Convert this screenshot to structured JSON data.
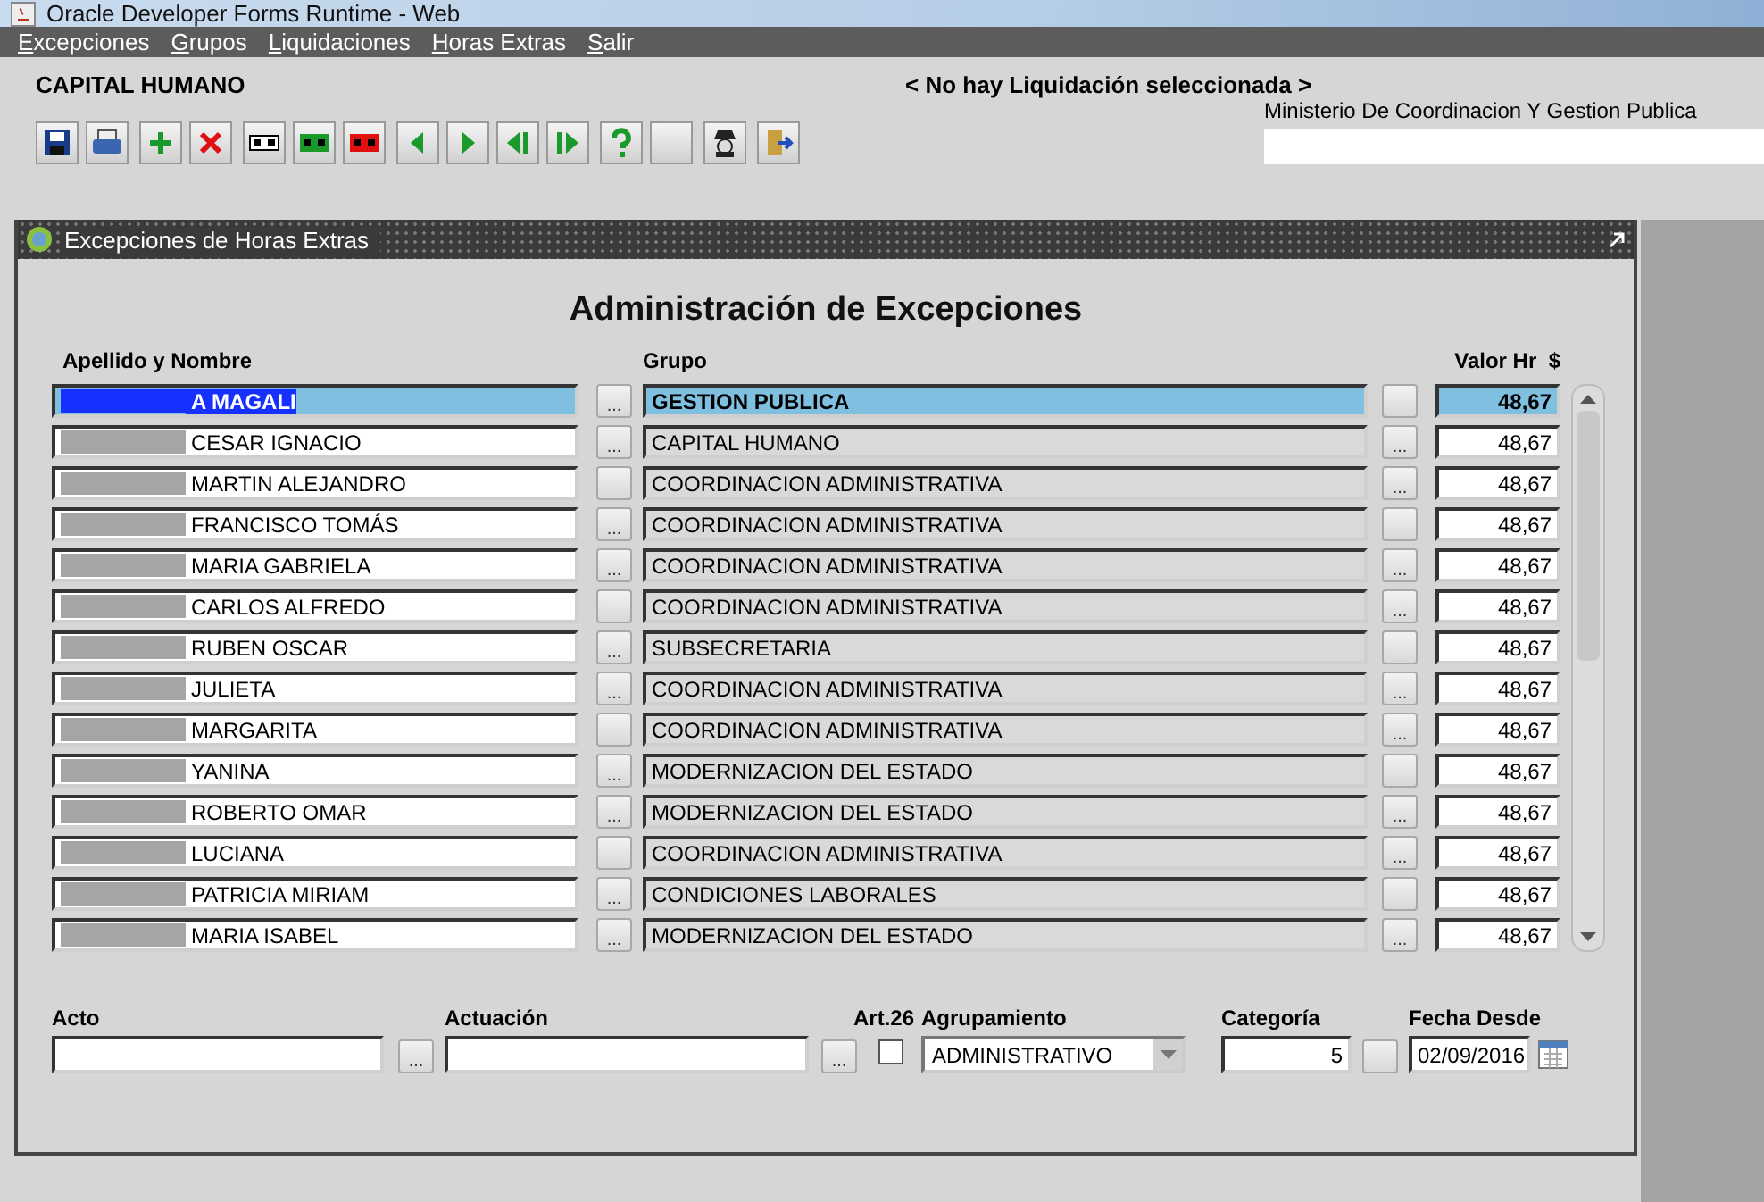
{
  "window": {
    "title": "Oracle Developer Forms Runtime - Web"
  },
  "menu": [
    "Excepciones",
    "Grupos",
    "Liquidaciones",
    "Horas Extras",
    "Salir"
  ],
  "header": {
    "area": "CAPITAL HUMANO",
    "liquidacion": "< No hay Liquidación seleccionada >",
    "ministerio": "Ministerio De Coordinacion Y Gestion Publica"
  },
  "form": {
    "title": "Excepciones de Horas Extras",
    "heading": "Administración de Excepciones",
    "columns": [
      "Apellido y Nombre",
      "Grupo",
      "Valor Hr  $"
    ],
    "rows": [
      {
        "name": "A MAGALI",
        "redacted": true,
        "name_button": "...",
        "grupo": "GESTION PUBLICA",
        "valor": "48,67",
        "selected": true
      },
      {
        "name": "CESAR IGNACIO",
        "redacted": true,
        "name_button": "...",
        "grupo": "CAPITAL HUMANO",
        "grupo_button": "...",
        "valor": "48,67",
        "selected": false
      },
      {
        "name": "MARTIN ALEJANDRO",
        "redacted": true,
        "grupo": "COORDINACION ADMINISTRATIVA",
        "grupo_button": "...",
        "valor": "48,67",
        "selected": false
      },
      {
        "name": "FRANCISCO TOMÁS",
        "redacted": true,
        "name_button": "...",
        "grupo": "COORDINACION ADMINISTRATIVA",
        "valor": "48,67",
        "selected": false
      },
      {
        "name": "MARIA GABRIELA",
        "redacted": true,
        "name_button": "...",
        "grupo": "COORDINACION ADMINISTRATIVA",
        "grupo_button": "...",
        "valor": "48,67",
        "selected": false
      },
      {
        "name": "CARLOS ALFREDO",
        "redacted": true,
        "grupo": "COORDINACION ADMINISTRATIVA",
        "grupo_button": "...",
        "valor": "48,67",
        "selected": false
      },
      {
        "name": "RUBEN OSCAR",
        "redacted": true,
        "name_button": "...",
        "grupo": "SUBSECRETARIA",
        "valor": "48,67",
        "selected": false
      },
      {
        "name": "JULIETA",
        "redacted": true,
        "name_button": "...",
        "grupo": "COORDINACION ADMINISTRATIVA",
        "grupo_button": "...",
        "valor": "48,67",
        "selected": false
      },
      {
        "name": "MARGARITA",
        "redacted": true,
        "grupo": "COORDINACION ADMINISTRATIVA",
        "grupo_button": "...",
        "valor": "48,67",
        "selected": false
      },
      {
        "name": "YANINA",
        "redacted": true,
        "name_button": "...",
        "grupo": "MODERNIZACION DEL ESTADO",
        "valor": "48,67",
        "selected": false
      },
      {
        "name": "ROBERTO OMAR",
        "redacted": true,
        "name_button": "...",
        "grupo": "MODERNIZACION DEL ESTADO",
        "grupo_button": "...",
        "valor": "48,67",
        "selected": false
      },
      {
        "name": "LUCIANA",
        "redacted": true,
        "grupo": "COORDINACION ADMINISTRATIVA",
        "grupo_button": "...",
        "valor": "48,67",
        "selected": false
      },
      {
        "name": "PATRICIA MIRIAM",
        "redacted": true,
        "name_button": "...",
        "grupo": "CONDICIONES LABORALES",
        "valor": "48,67",
        "selected": false
      },
      {
        "name": "MARIA ISABEL",
        "redacted": true,
        "name_button": "...",
        "grupo": "MODERNIZACION DEL ESTADO",
        "grupo_button": "...",
        "valor": "48,67",
        "selected": false
      }
    ],
    "footer": {
      "acto_label": "Acto",
      "acto_button": "...",
      "actuacion_label": "Actuación",
      "actuacion_button": "...",
      "art26_label": "Art.26",
      "art26_checked": false,
      "agrupamiento_label": "Agrupamiento",
      "agrupamiento": "ADMINISTRATIVO",
      "categoria_label": "Categoría",
      "categoria": "5",
      "fecha_label": "Fecha Desde",
      "fecha": "02/09/2016"
    }
  }
}
